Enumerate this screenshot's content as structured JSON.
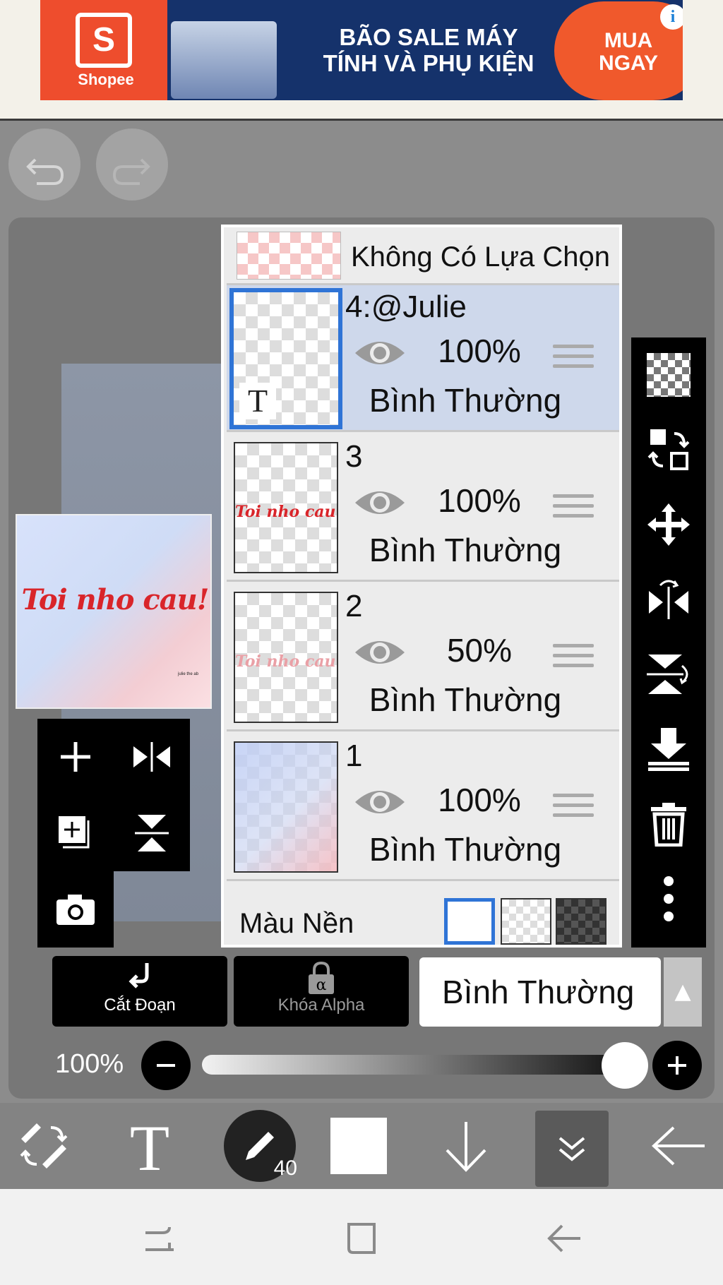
{
  "ad": {
    "brand": "Shopee",
    "headline_line1": "BÃO SALE MÁY",
    "headline_line2": "TÍNH VÀ PHỤ KIỆN",
    "cta_line1": "MUA",
    "cta_line2": "NGAY",
    "info_icon": "i",
    "close_icon": "✕"
  },
  "canvas": {
    "preview_text": "Toi nho cau!",
    "preview_small_text": "julie the ab"
  },
  "layers": {
    "no_selection_label": "Không Có Lựa Chọn",
    "items": [
      {
        "name": "4:@Julie",
        "opacity": "100%",
        "blend": "Bình Thường",
        "selected": true,
        "thumb_text": "T"
      },
      {
        "name": "3",
        "opacity": "100%",
        "blend": "Bình Thường",
        "selected": false,
        "thumb_text": "Toi nho cau"
      },
      {
        "name": "2",
        "opacity": "50%",
        "blend": "Bình Thường",
        "selected": false,
        "thumb_text": "Toi nho cau"
      },
      {
        "name": "1",
        "opacity": "100%",
        "blend": "Bình Thường",
        "selected": false,
        "thumb_text": ""
      }
    ],
    "background_label": "Màu Nền"
  },
  "actions": {
    "clip_label": "Cắt Đoạn",
    "alpha_lock_label": "Khóa Alpha",
    "alpha_lock_symbol": "α",
    "blend_mode": "Bình Thường"
  },
  "opacity": {
    "label": "100%",
    "value": 1.0
  },
  "bottom_toolbar": {
    "brush_size": "40"
  },
  "colors": {
    "selected_border": "#2f74d6",
    "selected_row": "#ced8eb",
    "panel_bg": "#ececec",
    "toolbar_bg": "#000000",
    "ad_cta": "#f0592c"
  }
}
